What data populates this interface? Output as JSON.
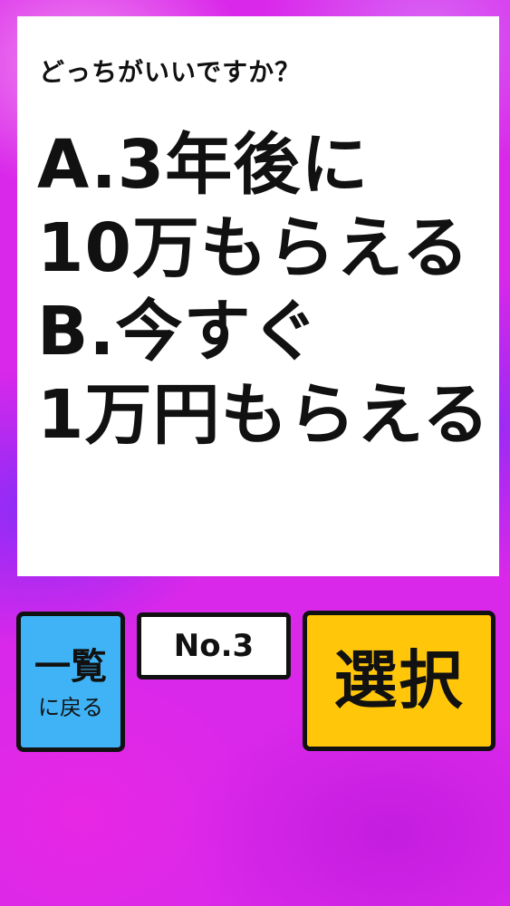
{
  "question": {
    "prompt": "どっちがいいですか？",
    "lines": [
      "A.3年後に",
      "10万もらえる",
      "B.今すぐ",
      "1万円もらえる"
    ]
  },
  "controls": {
    "back_label_line1": "一覧",
    "back_label_line2": "に戻る",
    "number_label": "No.3",
    "select_label": "選択"
  },
  "colors": {
    "back_button": "#3fb3f5",
    "select_button": "#ffc60a",
    "background": "#d928ea"
  }
}
